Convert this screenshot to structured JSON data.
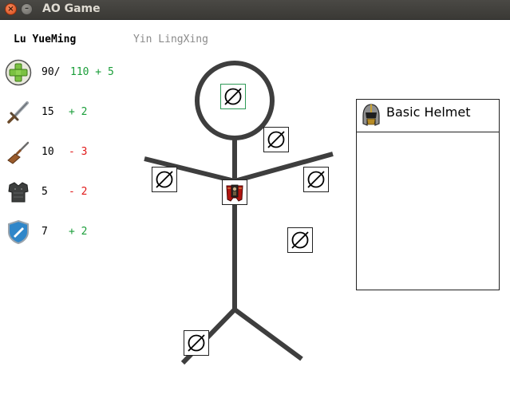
{
  "window": {
    "title": "AO Game"
  },
  "tabs": [
    {
      "label": "Lu YueMing",
      "active": true
    },
    {
      "label": "Yin LingXing",
      "active": false
    }
  ],
  "stats": [
    {
      "icon": "health-plus-icon",
      "base": "90/",
      "mod": "110 + 5",
      "mod_color": "#1b9e3a"
    },
    {
      "icon": "sword-icon",
      "base": "15",
      "mod": "+ 2",
      "mod_color": "#1b9e3a"
    },
    {
      "icon": "rifle-icon",
      "base": "10",
      "mod": "- 3",
      "mod_color": "#e01818"
    },
    {
      "icon": "armor-icon",
      "base": "5",
      "mod": "- 2",
      "mod_color": "#e01818"
    },
    {
      "icon": "shield-icon",
      "base": "7",
      "mod": "+ 2",
      "mod_color": "#1b9e3a"
    }
  ],
  "equipment_slots": [
    {
      "slot": "head",
      "state": "empty",
      "selected": true
    },
    {
      "slot": "neck",
      "state": "empty"
    },
    {
      "slot": "right-hand",
      "state": "empty"
    },
    {
      "slot": "torso",
      "state": "armor-equipped"
    },
    {
      "slot": "left-hand",
      "state": "empty"
    },
    {
      "slot": "belt",
      "state": "empty"
    },
    {
      "slot": "feet",
      "state": "empty"
    }
  ],
  "item_panel": {
    "icon": "helmet-icon",
    "name": "Basic Helmet"
  },
  "colors": {
    "positive": "#1b9e3a",
    "negative": "#e01818",
    "selected_border": "#2e9a57"
  }
}
